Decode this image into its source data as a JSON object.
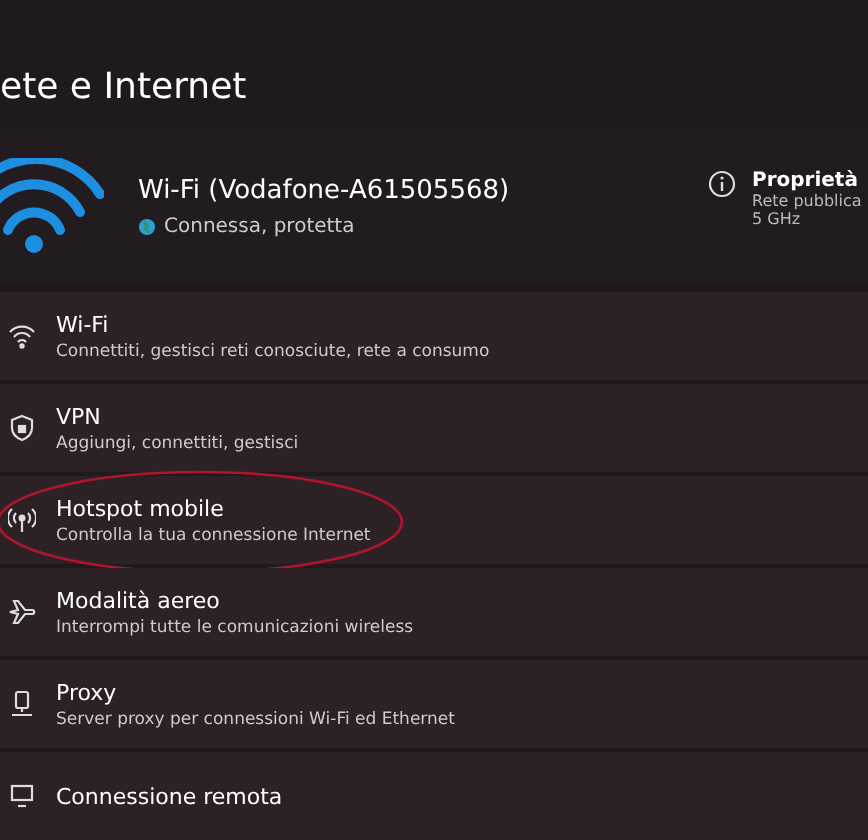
{
  "title": "ete e Internet",
  "connection": {
    "name": "Wi-Fi (Vodafone-A61505568)",
    "status": "Connessa, protetta",
    "properties": {
      "label": "Proprietà",
      "lines": [
        "Rete pubblica",
        "5 GHz"
      ]
    }
  },
  "items": [
    {
      "kind": "wifi",
      "title": "Wi-Fi",
      "subtitle": "Connettiti, gestisci reti conosciute, rete a consumo",
      "highlighted": false
    },
    {
      "kind": "vpn",
      "title": "VPN",
      "subtitle": "Aggiungi, connettiti, gestisci",
      "highlighted": false
    },
    {
      "kind": "hotspot",
      "title": "Hotspot mobile",
      "subtitle": "Controlla la tua connessione Internet",
      "highlighted": true
    },
    {
      "kind": "airplane",
      "title": "Modalità aereo",
      "subtitle": "Interrompi tutte le comunicazioni wireless",
      "highlighted": false
    },
    {
      "kind": "proxy",
      "title": "Proxy",
      "subtitle": "Server proxy per connessioni Wi-Fi ed Ethernet",
      "highlighted": false
    },
    {
      "kind": "remote",
      "title": "Connessione remota",
      "highlighted": false
    }
  ]
}
